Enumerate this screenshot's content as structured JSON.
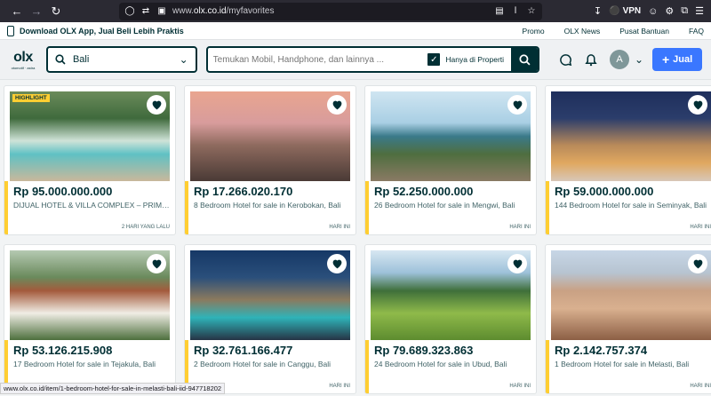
{
  "browser": {
    "url_prefix": "www.",
    "url_host": "olx.co.id",
    "url_path": "/myfavorites",
    "vpn_label": "VPN"
  },
  "promo": {
    "download_text": "Download OLX App, Jual Beli Lebih Praktis",
    "links": [
      "Promo",
      "OLX News",
      "Pusat Bantuan",
      "FAQ"
    ]
  },
  "header": {
    "logo": "olx",
    "logo_sub": "otomotif · astra",
    "location_value": "Bali",
    "search_placeholder": "Temukan Mobil, Handphone, dan lainnya ...",
    "property_checkbox_label": "Hanya di Properti",
    "avatar_letter": "A",
    "sell_label": "Jual"
  },
  "listings": [
    {
      "price": "Rp 95.000.000.000",
      "title": "DIJUAL HOTEL & VILLA COMPLEX – PRIME LOCATION",
      "date": "2 HARI YANG LALU",
      "highlight": "HIGHLIGHT",
      "scene": "pool"
    },
    {
      "price": "Rp 17.266.020.170",
      "title": "8 Bedroom Hotel for sale in Kerobokan, Bali",
      "date": "HARI INI",
      "highlight": "",
      "scene": "sunset"
    },
    {
      "price": "Rp 52.250.000.000",
      "title": "26 Bedroom Hotel for sale in Mengwi, Bali",
      "date": "HARI INI",
      "highlight": "",
      "scene": "coast"
    },
    {
      "price": "Rp 59.000.000.000",
      "title": "144 Bedroom Hotel for sale in Seminyak, Bali",
      "date": "HARI INI",
      "highlight": "",
      "scene": "night"
    },
    {
      "price": "Rp 53.126.215.908",
      "title": "17 Bedroom Hotel for sale in Tejakula, Bali",
      "date": "HARI INI",
      "highlight": "",
      "scene": "villa"
    },
    {
      "price": "Rp 32.761.166.477",
      "title": "2 Bedroom Hotel for sale in Canggu, Bali",
      "date": "HARI INI",
      "highlight": "",
      "scene": "evening"
    },
    {
      "price": "Rp 79.689.323.863",
      "title": "24 Bedroom Hotel for sale in Ubud, Bali",
      "date": "HARI INI",
      "highlight": "",
      "scene": "rice"
    },
    {
      "price": "Rp 2.142.757.374",
      "title": "1 Bedroom Hotel for sale in Melasti, Bali",
      "date": "HARI INI",
      "highlight": "",
      "scene": "resort"
    }
  ],
  "status_url": "www.olx.co.id/item/1-bedroom-hotel-for-sale-in-melasti-bali-iid-947718202"
}
